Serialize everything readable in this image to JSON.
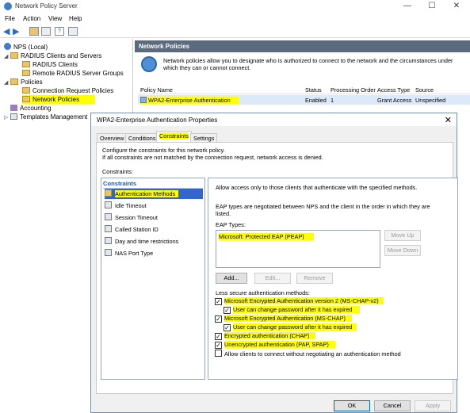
{
  "window": {
    "title": "Network Policy Server",
    "min": "—",
    "max": "☐",
    "close": "✕"
  },
  "menu": [
    "File",
    "Action",
    "View",
    "Help"
  ],
  "tree": {
    "root": "NPS (Local)",
    "radius_clients_servers": "RADIUS Clients and Servers",
    "radius_clients": "RADIUS Clients",
    "remote_groups": "Remote RADIUS Server Groups",
    "policies": "Policies",
    "connection_request": "Connection Request Policies",
    "network_policies": "Network Policies",
    "accounting": "Accounting",
    "templates": "Templates Management"
  },
  "right": {
    "header": "Network Policies",
    "description": "Network policies allow you to designate who is authorized to connect to the network and the circumstances under which they can or cannot connect.",
    "columns": [
      "Policy Name",
      "Status",
      "Processing Order",
      "Access Type",
      "Source"
    ],
    "row": {
      "name": "WPA2-Enterprise Authentication",
      "status": "Enabled",
      "order": "1",
      "access": "Grant Access",
      "source": "Unspecified"
    }
  },
  "dialog": {
    "title": "WPA2-Enterprise Authentication Properties",
    "close": "✕",
    "tabs": [
      "Overview",
      "Conditions",
      "Constraints",
      "Settings"
    ],
    "active_tab": "Constraints",
    "intro1": "Configure the constraints for this network policy.",
    "intro2": "If all constraints are not matched by the connection request, network access is denied.",
    "constraints_label": "Constraints:",
    "group": "Constraints",
    "items": [
      "Authentication Methods",
      "Idle Timeout",
      "Session Timeout",
      "Called Station ID",
      "Day and time restrictions",
      "NAS Port Type"
    ],
    "detail": {
      "allow_text": "Allow access only to those clients that authenticate with the specified methods.",
      "eap_text1": "EAP types are negotiated between NPS and the client in the order in which they are",
      "eap_text2": "listed.",
      "eap_types_label": "EAP Types:",
      "eap_types": [
        "Microsoft: Protected EAP (PEAP)"
      ],
      "move_up": "Move Up",
      "move_down": "Move Down",
      "add": "Add...",
      "edit": "Edit...",
      "remove": "Remove",
      "less_secure": "Less secure authentication methods:",
      "checks": [
        {
          "label": "Microsoft Encrypted Authentication version 2 (MS-CHAP-v2)",
          "checked": true
        },
        {
          "label": "User can change password after it has expired",
          "checked": true
        },
        {
          "label": "Microsoft Encrypted Authentication (MS-CHAP)",
          "checked": true
        },
        {
          "label": "User can change password after it has expired",
          "checked": true
        },
        {
          "label": "Encrypted authentication (CHAP)",
          "checked": true
        },
        {
          "label": "Unencrypted authentication (PAP, SPAP)",
          "checked": true
        },
        {
          "label": "Allow clients to connect without negotiating an authentication method",
          "checked": false
        }
      ]
    },
    "ok": "OK",
    "cancel": "Cancel",
    "apply": "Apply"
  }
}
